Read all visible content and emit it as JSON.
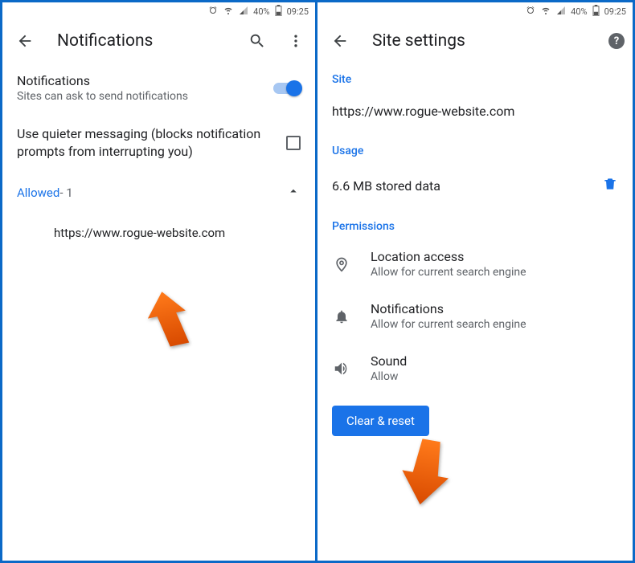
{
  "status": {
    "battery_pct": "40%",
    "time": "09:25"
  },
  "left": {
    "title": "Notifications",
    "notif": {
      "label": "Notifications",
      "desc": "Sites can ask to send notifications"
    },
    "quieter": "Use quieter messaging (blocks notification prompts from interrupting you)",
    "allowed": {
      "label": "Allowed",
      "count": " - 1"
    },
    "site": "https://www.rogue-website.com"
  },
  "right": {
    "title": "Site settings",
    "site_head": "Site",
    "site_url": "https://www.rogue-website.com",
    "usage_head": "Usage",
    "usage_text": "6.6 MB stored data",
    "perm_head": "Permissions",
    "perms": {
      "location": {
        "title": "Location access",
        "desc": "Allow for current search engine"
      },
      "notifications": {
        "title": "Notifications",
        "desc": "Allow for current search engine"
      },
      "sound": {
        "title": "Sound",
        "desc": "Allow"
      }
    },
    "clear_btn": "Clear & reset"
  }
}
